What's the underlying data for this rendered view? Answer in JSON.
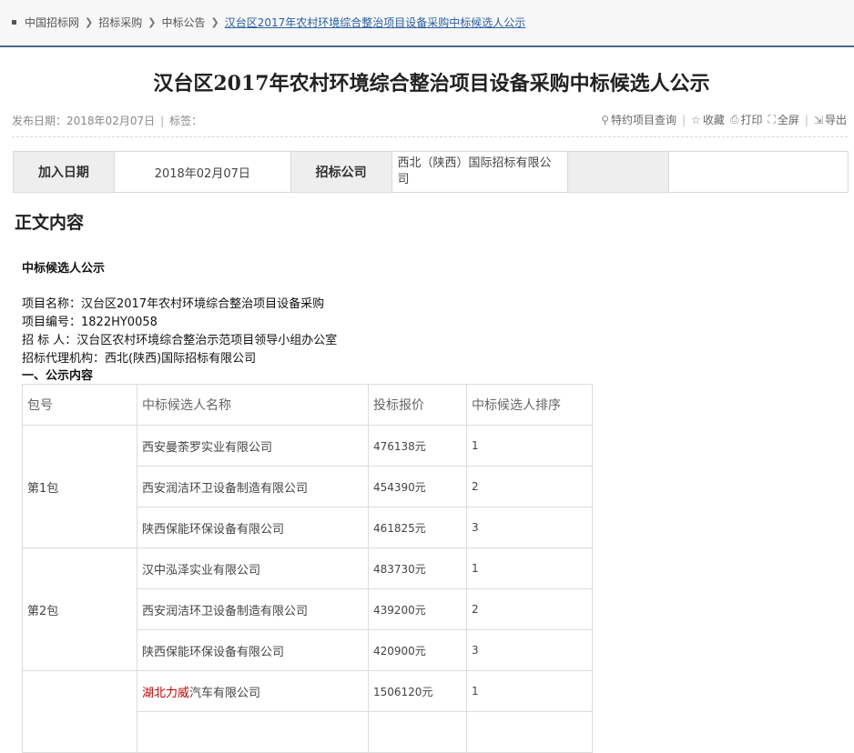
{
  "breadcrumb": {
    "items": [
      "中国招标网",
      "招标采购",
      "中标公告"
    ],
    "current": "汉台区2017年农村环境综合整治项目设备采购中标候选人公示"
  },
  "page_title": "汉台区2017年农村环境综合整治项目设备采购中标候选人公示",
  "meta": {
    "publish_label": "发布日期：",
    "publish_date": "2018年02月07日",
    "tag_label": "标签：",
    "actions": [
      {
        "icon": "search-icon",
        "label": "特约项目查询"
      },
      {
        "icon": "star-icon",
        "label": "收藏"
      },
      {
        "icon": "printer-icon",
        "label": "打印"
      },
      {
        "icon": "fullscreen-icon",
        "label": "全屏"
      },
      {
        "icon": "export-icon",
        "label": "导出"
      }
    ]
  },
  "info_table": {
    "join_date_label": "加入日期",
    "join_date": "2018年02月07日",
    "agency_label": "招标公司",
    "agency": "西北（陕西）国际招标有限公司"
  },
  "section_heading": "正文内容",
  "notice": {
    "heading": "中标候选人公示",
    "project_name": "项目名称：汉台区2017年农村环境综合整治项目设备采购",
    "project_no": "项目编号：1822HY0058",
    "tenderer": "招 标 人：汉台区农村环境综合整治示范项目领导小组办公室",
    "agent": "招标代理机构：西北(陕西)国际招标有限公司",
    "sub_heading": "一、公示内容"
  },
  "result_table": {
    "headers": [
      "包号",
      "中标候选人名称",
      "投标报价",
      "中标候选人排序"
    ],
    "packages": [
      {
        "name": "第1包",
        "rows": [
          {
            "company": "西安曼荼罗实业有限公司",
            "price": "476138元",
            "rank": "1"
          },
          {
            "company": "西安润洁环卫设备制造有限公司",
            "price": "454390元",
            "rank": "2"
          },
          {
            "company": "陕西保能环保设备有限公司",
            "price": "461825元",
            "rank": "3"
          }
        ]
      },
      {
        "name": "第2包",
        "rows": [
          {
            "company": "汉中泓泽实业有限公司",
            "price": "483730元",
            "rank": "1"
          },
          {
            "company": "西安润洁环卫设备制造有限公司",
            "price": "439200元",
            "rank": "2"
          },
          {
            "company": "陕西保能环保设备有限公司",
            "price": "420900元",
            "rank": "3"
          }
        ]
      },
      {
        "name": "",
        "rows": [
          {
            "company_highlight": "湖北力威",
            "company_rest": "汽车有限公司",
            "price": "1506120元",
            "rank": "1"
          }
        ]
      }
    ]
  },
  "colors": {
    "link": "#2a5fa0",
    "highlight": "#c00000",
    "rule": "#4a6d8c"
  }
}
